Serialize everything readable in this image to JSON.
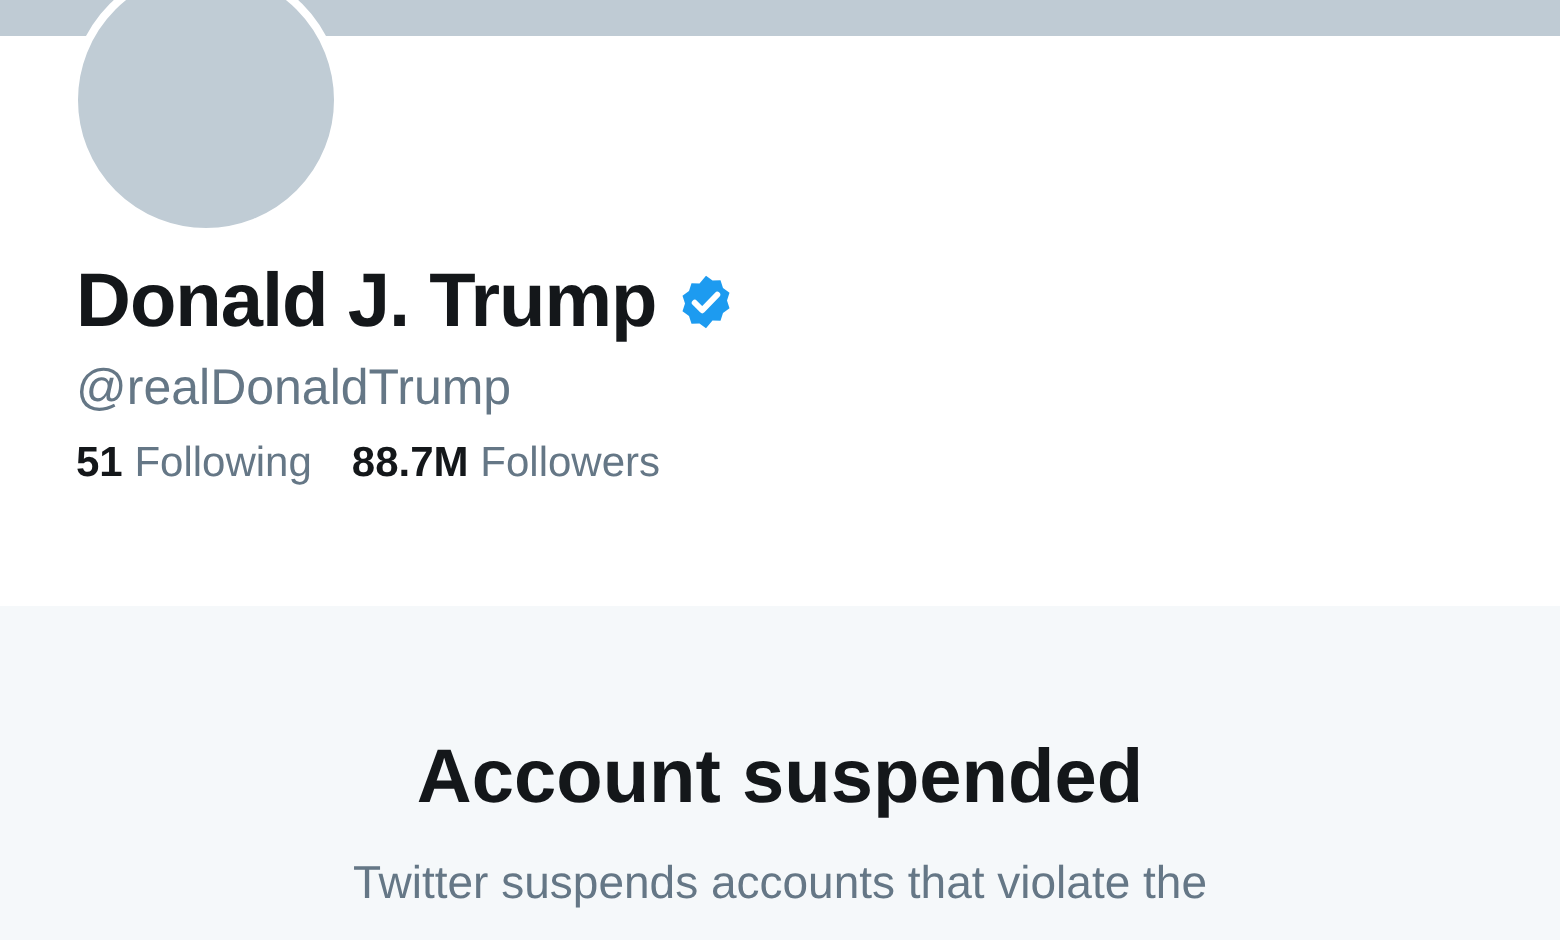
{
  "profile": {
    "name": "Donald J. Trump",
    "verified": true,
    "handle": "@realDonaldTrump",
    "stats": [
      {
        "count": "51",
        "label": "Following"
      },
      {
        "count": "88.7M",
        "label": "Followers"
      }
    ]
  },
  "notice": {
    "title": "Account suspended",
    "text": "Twitter suspends accounts that violate the"
  }
}
